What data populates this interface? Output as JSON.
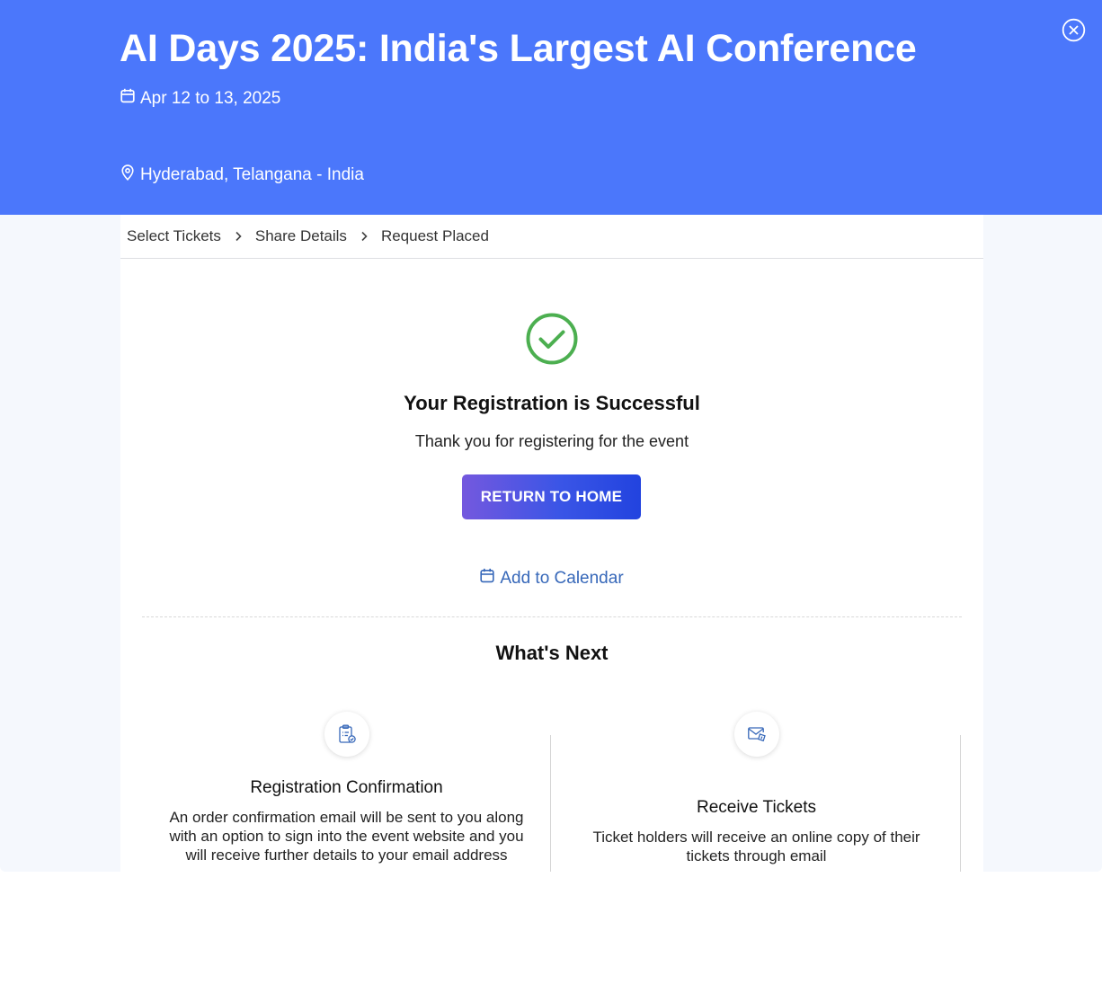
{
  "event": {
    "title": "AI Days 2025: India's Largest AI Conference",
    "date": "Apr 12 to 13, 2025",
    "location": "Hyderabad, Telangana - India"
  },
  "breadcrumb": {
    "steps": [
      "Select Tickets",
      "Share Details",
      "Request Placed"
    ]
  },
  "success": {
    "title": "Your Registration is Successful",
    "subtitle": "Thank you for registering for the event",
    "home_button": "RETURN TO HOME",
    "calendar_link": "Add to Calendar"
  },
  "whats_next": {
    "title": "What's Next",
    "items": [
      {
        "title": "Registration Confirmation",
        "description": "An order confirmation email will be sent to you along with an option to sign into the event website and you will receive further details to your email address"
      },
      {
        "title": "Receive Tickets",
        "description": "Ticket holders will receive an online copy of their tickets through email"
      }
    ]
  },
  "colors": {
    "hero": "#4b77fb",
    "success": "#4caf50",
    "link": "#3768b9",
    "button_start": "#7458de",
    "button_end": "#2243df"
  }
}
